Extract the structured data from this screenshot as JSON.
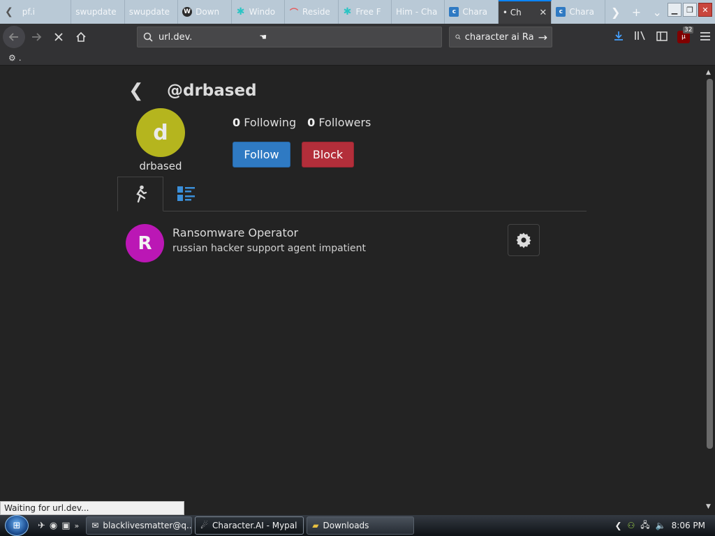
{
  "browser": {
    "tabs": [
      {
        "label": "pf.i",
        "icon": "document-icon",
        "fav_color": "#7a8a96"
      },
      {
        "label": "swupdate",
        "icon": "",
        "fav_color": ""
      },
      {
        "label": "swupdate",
        "icon": "",
        "fav_color": ""
      },
      {
        "label": "Down",
        "icon": "w-logo-icon",
        "fav_color": "#2b2b2b"
      },
      {
        "label": "Windo",
        "icon": "puzzle-icon",
        "fav_color": "#2bc4c4"
      },
      {
        "label": "Reside",
        "icon": "rainbow-icon",
        "fav_color": "#e65b5b"
      },
      {
        "label": "Free F",
        "icon": "puzzle-icon",
        "fav_color": "#2bc4c4"
      },
      {
        "label": "Him - Cha",
        "icon": "",
        "fav_color": ""
      },
      {
        "label": "Chara",
        "icon": "character-ai-icon",
        "fav_color": "#2f7ac3"
      },
      {
        "label": "• Ch",
        "icon": "",
        "fav_color": "",
        "active": true
      },
      {
        "label": "Chara",
        "icon": "character-ai-icon",
        "fav_color": "#2f7ac3"
      }
    ],
    "url": "url.dev.",
    "search_text": "character ai Ra",
    "ublock_count": "32",
    "bookmark_label": "."
  },
  "profile": {
    "handle": "@drbased",
    "avatar_letter": "d",
    "avatar_color": "#b5b51e",
    "username": "drbased",
    "following_count": "0",
    "following_label": "Following",
    "followers_count": "0",
    "followers_label": "Followers",
    "follow_label": "Follow",
    "block_label": "Block"
  },
  "characters": [
    {
      "letter": "R",
      "color": "#bb17b5",
      "name": "Ransomware Operator",
      "description": "russian hacker support agent impatient"
    }
  ],
  "status_text": "Waiting for url.dev...",
  "taskbar": {
    "tasks": [
      {
        "label": "blacklivesmatter@q...",
        "icon": "email-icon"
      },
      {
        "label": "Character.AI - Mypal",
        "icon": "mypal-browser-icon",
        "active": true
      },
      {
        "label": "Downloads",
        "icon": "folder-icon"
      }
    ],
    "clock": "8:06 PM"
  }
}
